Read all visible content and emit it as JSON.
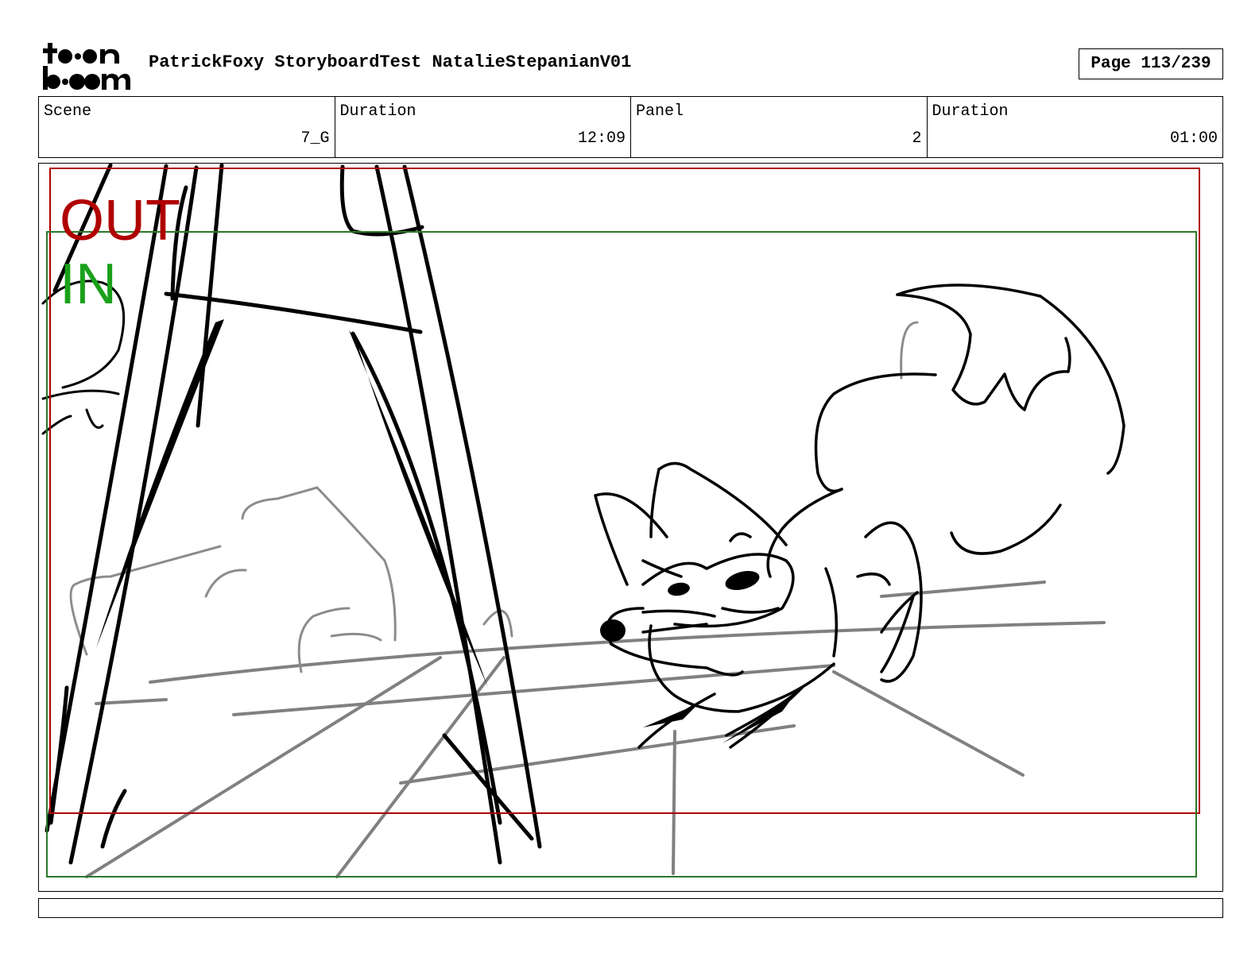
{
  "header": {
    "logo_text": "toon boom",
    "document_title": "PatrickFoxy StoryboardTest NatalieStepanianV01",
    "page_indicator": "Page 113/239"
  },
  "info": {
    "scene_label": "Scene",
    "scene_value": "7_G",
    "scene_duration_label": "Duration",
    "scene_duration_value": "12:09",
    "panel_label": "Panel",
    "panel_value": "2",
    "panel_duration_label": "Duration",
    "panel_duration_value": "01:00"
  },
  "panel": {
    "out_label": "OUT",
    "in_label": "IN",
    "out_color": "#b00000",
    "in_color": "#1aa01a"
  },
  "footer": {
    "caption": ""
  }
}
